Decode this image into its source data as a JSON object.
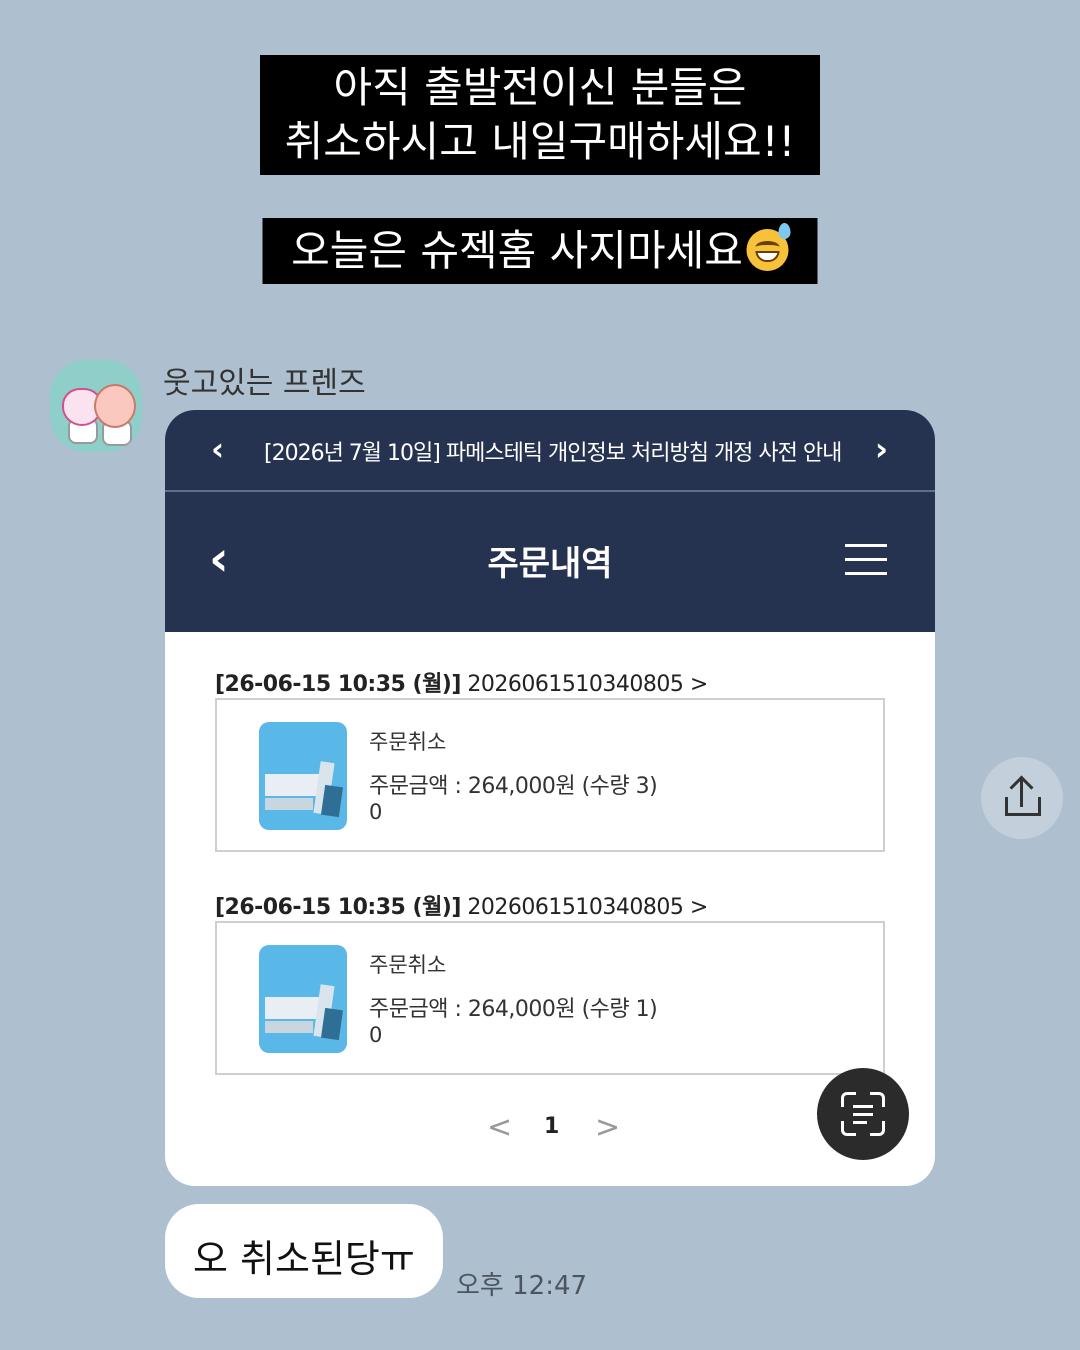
{
  "captions": {
    "line1": "아직 출발전이신 분들은",
    "line2": "취소하시고 내일구매하세요!!",
    "line3": "오늘은 슈젝홈 사지마세요"
  },
  "chat": {
    "sender_name": "웃고있는 프렌즈",
    "reply_text": "오 취소된당ㅠ",
    "timestamp": "오후 12:47"
  },
  "shared_screenshot": {
    "notice_text": "[2026년 7월 10일] 파메스테틱 개인정보 처리방침 개정 사전 안내",
    "page_title": "주문내역",
    "orders": [
      {
        "date": "[26-06-15 10:35 (월)]",
        "order_no": "2026061510340805 >",
        "status": "주문취소",
        "amount": "주문금액 : 264,000원 (수량 3)",
        "extra": "0"
      },
      {
        "date": "[26-06-15 10:35 (월)]",
        "order_no": "2026061510340805 >",
        "status": "주문취소",
        "amount": "주문금액 : 264,000원 (수량 1)",
        "extra": "0"
      }
    ],
    "pager": {
      "prev": "<",
      "current": "1",
      "next": ">"
    }
  },
  "icons": {
    "emoji": "grinning-sweat-emoji",
    "avatar": "kakao-friends-avatar",
    "share": "share-icon",
    "scan": "text-scan-icon"
  }
}
